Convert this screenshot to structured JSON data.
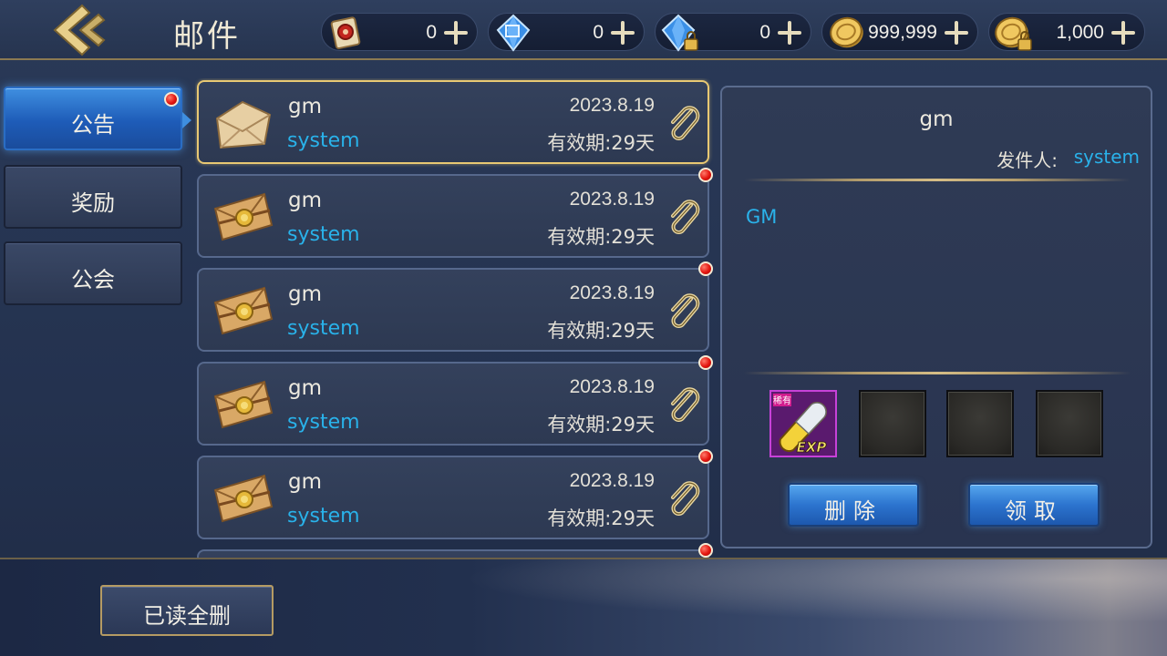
{
  "header": {
    "title": "邮件",
    "resources": [
      {
        "icon": "scroll-ticket-icon",
        "value": "0"
      },
      {
        "icon": "blue-diamond-icon",
        "value": "0"
      },
      {
        "icon": "locked-diamond-icon",
        "value": "0"
      },
      {
        "icon": "gold-coin-icon",
        "value": "999,999"
      },
      {
        "icon": "locked-gold-coin-icon",
        "value": "1,000"
      }
    ]
  },
  "tabs": [
    {
      "label": "公告",
      "active": true,
      "has_notice": true
    },
    {
      "label": "奖励",
      "active": false,
      "has_notice": false
    },
    {
      "label": "公会",
      "active": false,
      "has_notice": false
    }
  ],
  "mails": [
    {
      "title": "gm",
      "sender": "system",
      "date": "2023.8.19",
      "expire": "有效期:29天",
      "opened": true,
      "unread": false,
      "has_attachment": true
    },
    {
      "title": "gm",
      "sender": "system",
      "date": "2023.8.19",
      "expire": "有效期:29天",
      "opened": false,
      "unread": true,
      "has_attachment": true
    },
    {
      "title": "gm",
      "sender": "system",
      "date": "2023.8.19",
      "expire": "有效期:29天",
      "opened": false,
      "unread": true,
      "has_attachment": true
    },
    {
      "title": "gm",
      "sender": "system",
      "date": "2023.8.19",
      "expire": "有效期:29天",
      "opened": false,
      "unread": true,
      "has_attachment": true
    },
    {
      "title": "gm",
      "sender": "system",
      "date": "2023.8.19",
      "expire": "有效期:29天",
      "opened": false,
      "unread": true,
      "has_attachment": true
    }
  ],
  "detail": {
    "title": "gm",
    "sender_label": "发件人:",
    "sender_name": "system",
    "body": "GM",
    "attachments": [
      {
        "icon": "exp-capsule-icon",
        "tag": "稀有",
        "text": "EXP"
      },
      {
        "icon": "empty-slot"
      },
      {
        "icon": "empty-slot"
      },
      {
        "icon": "empty-slot"
      }
    ],
    "delete_label": "删除",
    "claim_label": "领取"
  },
  "footer": {
    "delete_read_label": "已读全删"
  },
  "colors": {
    "accent_blue": "#29b2ea",
    "gold_border": "#e8c873",
    "notice_red": "#e3150f"
  }
}
